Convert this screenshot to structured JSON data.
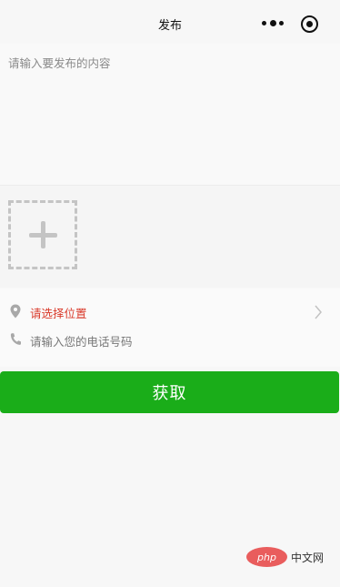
{
  "header": {
    "title": "发布",
    "more_icon": "more-dots-icon",
    "target_icon": "target-icon"
  },
  "content": {
    "placeholder": "请输入要发布的内容"
  },
  "upload": {
    "icon": "plus-icon"
  },
  "form": {
    "location_label": "请选择位置",
    "location_icon": "location-pin-icon",
    "location_color": "#d9392a",
    "phone_placeholder": "请输入您的电话号码",
    "phone_icon": "phone-icon"
  },
  "submit": {
    "label": "获取",
    "color": "#1aad19"
  },
  "watermark": {
    "logo_text": "php",
    "site_text": "中文网"
  }
}
